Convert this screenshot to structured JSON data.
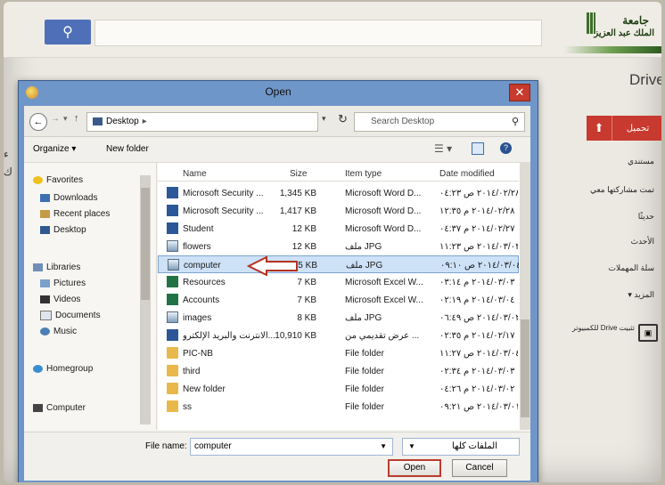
{
  "app": {
    "logo_line1": "جامعة",
    "logo_line2": "الملك عبد العزيز",
    "drive_title": "Drive",
    "upload_label": "تحميل",
    "upload_icon": "upload-arrow-icon",
    "sidebar_items": [
      "مستندي",
      "تمت مشاركتها معي",
      "حديثًا",
      "الأحدث",
      "سلة المهملات",
      "المزيد ▾"
    ],
    "pc_label": "تثبيت Drive للكمبيوتر",
    "left_edge_chars": [
      "ء",
      "ك"
    ]
  },
  "dialog": {
    "title": "Open",
    "close_label": "✕",
    "path": "Desktop",
    "search_placeholder": "Search Desktop",
    "toolbar": {
      "organize": "Organize ▾",
      "new_folder": "New folder"
    },
    "nav_pane": [
      {
        "label": "Favorites",
        "icon": "star-icon"
      },
      {
        "label": "Downloads",
        "icon": "download-folder-icon"
      },
      {
        "label": "Recent places",
        "icon": "recent-places-icon"
      },
      {
        "label": "Desktop",
        "icon": "desktop-icon"
      },
      {
        "label": "Libraries",
        "icon": "library-icon"
      },
      {
        "label": "Pictures",
        "icon": "pictures-icon"
      },
      {
        "label": "Videos",
        "icon": "videos-icon"
      },
      {
        "label": "Documents",
        "icon": "documents-icon"
      },
      {
        "label": "Music",
        "icon": "music-icon"
      },
      {
        "label": "Homegroup",
        "icon": "homegroup-icon"
      },
      {
        "label": "Computer",
        "icon": "computer-icon"
      }
    ],
    "columns": [
      "Name",
      "Size",
      "Item type",
      "Date modified"
    ],
    "files": [
      {
        "name": "Microsoft Security ...",
        "size": "1,345 KB",
        "type": "Microsoft Word D...",
        "date": "٢٠١٤/٠٢/٢٨ ص ٠٤:٢٣",
        "icon": "word"
      },
      {
        "name": "Microsoft Security ...",
        "size": "1,417 KB",
        "type": "Microsoft Word D...",
        "date": "٢٠١٤/٠٢/٢٨ م ١٢:٣٥",
        "icon": "word"
      },
      {
        "name": "Student",
        "size": "12 KB",
        "type": "Microsoft Word D...",
        "date": "٢٠١٤/٠٢/٢٧ م ٠٤:٣٧",
        "icon": "word"
      },
      {
        "name": "flowers",
        "size": "12 KB",
        "type": "ملف JPG",
        "date": "٢٠١٤/٠٣/٠٣ ص ١١:٢٣",
        "icon": "img"
      },
      {
        "name": "computer",
        "size": "15 KB",
        "type": "ملف JPG",
        "date": "٢٠١٤/٠٣/٠٤ ص ٠٩:١٠",
        "icon": "img",
        "selected": true
      },
      {
        "name": "Resources",
        "size": "7 KB",
        "type": "Microsoft Excel W...",
        "date": "٢٠١٤/٠٣/٠٣ م ٠٣:١٤",
        "icon": "excel"
      },
      {
        "name": "Accounts",
        "size": "7 KB",
        "type": "Microsoft Excel W...",
        "date": "٢٠١٤/٠٣/٠٤ م ٠٢:١٩",
        "icon": "excel"
      },
      {
        "name": "images",
        "size": "8 KB",
        "type": "ملف JPG",
        "date": "٢٠١٤/٠٣/٠٢ ص ٠٦:٤٩",
        "icon": "img"
      },
      {
        "name": "الانترنت والبريد الإلكترو...",
        "size": "10,910 KB",
        "type": "عرض تقديمي من ...",
        "date": "٢٠١٤/٠٢/١٧ م ٠٢:٣٥",
        "icon": "word"
      },
      {
        "name": "PIC-NB",
        "size": "",
        "type": "File folder",
        "date": "٢٠١٤/٠٣/٠٤ ص ١١:٢٧",
        "icon": "folder"
      },
      {
        "name": "third",
        "size": "",
        "type": "File folder",
        "date": "٢٠١٤/٠٣/٠٣ م ٠٢:٣٤",
        "icon": "folder"
      },
      {
        "name": "New folder",
        "size": "",
        "type": "File folder",
        "date": "٢٠١٤/٠٣/٠٢ م ٠٤:٢٦",
        "icon": "folder"
      },
      {
        "name": "ss",
        "size": "",
        "type": "File folder",
        "date": "٢٠١٤/٠٣/٠١ ص ٠٩:٢١",
        "icon": "folder"
      }
    ],
    "file_name_label": "File name:",
    "file_name_value": "computer",
    "file_type_value": "الملفات كلها",
    "open_label": "Open",
    "cancel_label": "Cancel"
  }
}
